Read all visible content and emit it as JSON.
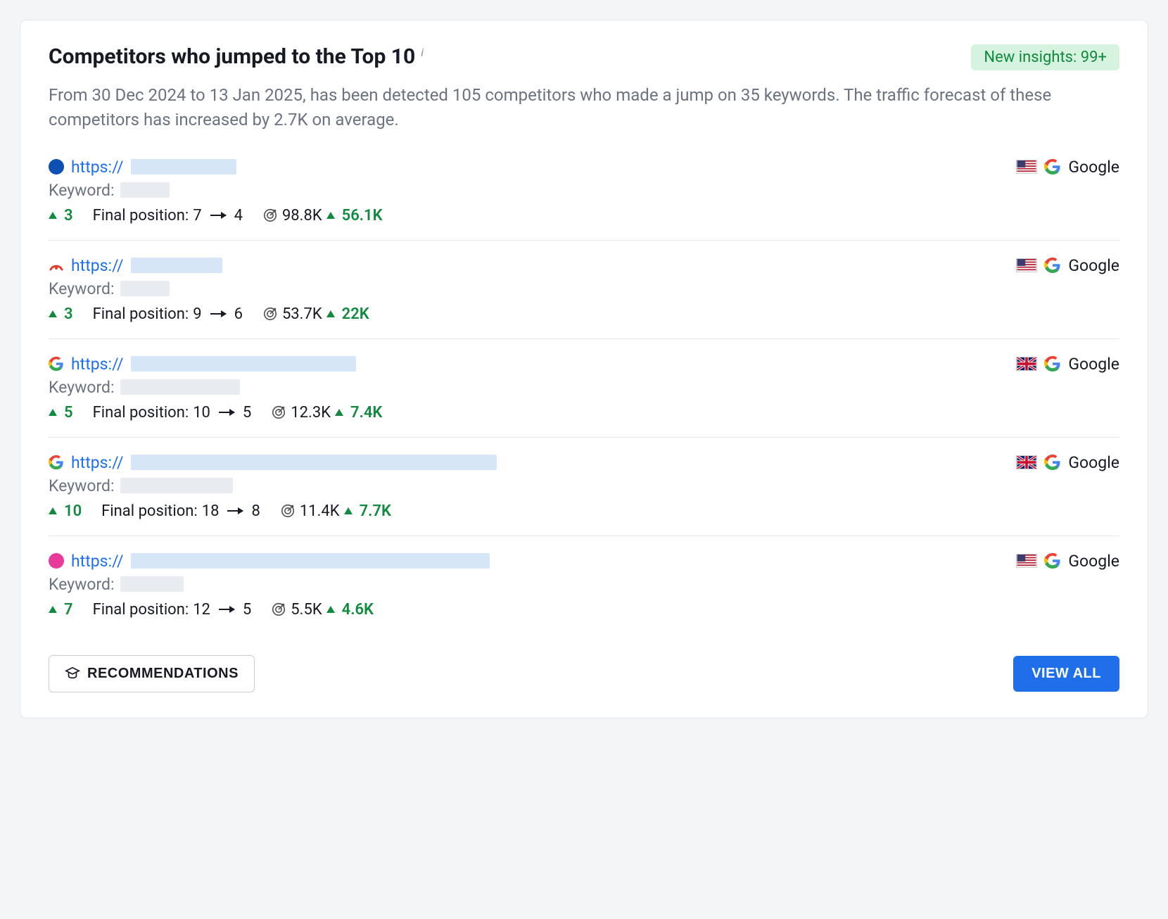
{
  "header": {
    "title": "Competitors who jumped to the Top 10",
    "badge": "New insights: 99+"
  },
  "description": "From 30 Dec 2024 to 13 Jan 2025, has been detected 105 competitors who made a jump on 35 keywords. The traffic forecast of these competitors has increased by 2.7K on average.",
  "labels": {
    "keyword_prefix": "Keyword:",
    "final_position_prefix": "Final position:",
    "engine": "Google",
    "recommendations": "RECOMMENDATIONS",
    "view_all": "VIEW ALL",
    "url_prefix": "https://"
  },
  "rows": [
    {
      "favicon_color": "#0e4fb3",
      "favicon_type": "dot",
      "url_blur_w": 150,
      "kw_blur_w": 70,
      "jump": "3",
      "pos_from": "7",
      "pos_to": "4",
      "traffic": "98.8K",
      "traffic_delta": "56.1K",
      "flag": "us"
    },
    {
      "favicon_color": "#e43b2f",
      "favicon_type": "arc",
      "url_blur_w": 130,
      "kw_blur_w": 70,
      "jump": "3",
      "pos_from": "9",
      "pos_to": "6",
      "traffic": "53.7K",
      "traffic_delta": "22K",
      "flag": "us"
    },
    {
      "favicon_color": "#ffffff",
      "favicon_type": "google",
      "url_blur_w": 320,
      "kw_blur_w": 170,
      "jump": "5",
      "pos_from": "10",
      "pos_to": "5",
      "traffic": "12.3K",
      "traffic_delta": "7.4K",
      "flag": "uk"
    },
    {
      "favicon_color": "#ffffff",
      "favicon_type": "google",
      "url_blur_w": 520,
      "kw_blur_w": 160,
      "jump": "10",
      "pos_from": "18",
      "pos_to": "8",
      "traffic": "11.4K",
      "traffic_delta": "7.7K",
      "flag": "uk"
    },
    {
      "favicon_color": "#e93a9c",
      "favicon_type": "dot",
      "url_blur_w": 510,
      "kw_blur_w": 90,
      "jump": "7",
      "pos_from": "12",
      "pos_to": "5",
      "traffic": "5.5K",
      "traffic_delta": "4.6K",
      "flag": "us"
    }
  ]
}
